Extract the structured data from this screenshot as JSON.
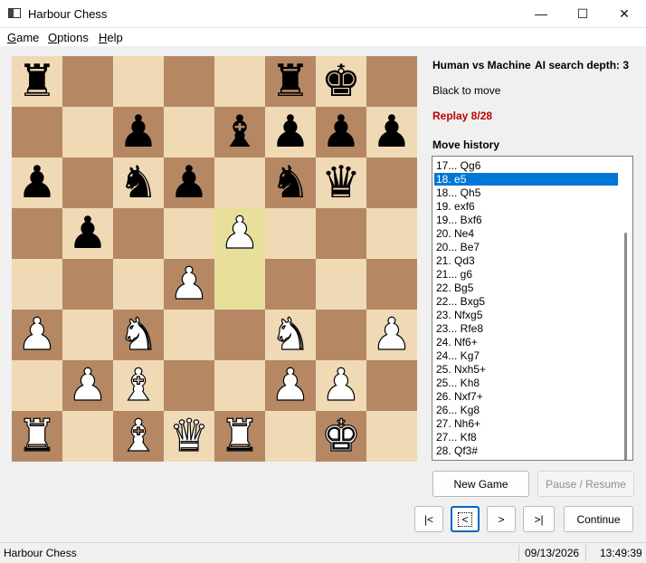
{
  "window": {
    "title": "Harbour Chess",
    "minimize": "—",
    "maximize": "☐",
    "close": "✕"
  },
  "menu": [
    {
      "accel": "G",
      "rest": "ame"
    },
    {
      "accel": "O",
      "rest": "ptions"
    },
    {
      "accel": "H",
      "rest": "elp"
    }
  ],
  "board": {
    "rows": [
      [
        "r",
        "",
        "",
        "",
        "",
        "r",
        "k",
        ""
      ],
      [
        "",
        "",
        "p",
        "",
        "b",
        "p",
        "p",
        "p"
      ],
      [
        "p",
        "",
        "n",
        "p",
        "",
        "n",
        "q",
        ""
      ],
      [
        "",
        "p",
        "",
        "",
        "P",
        "",
        "",
        ""
      ],
      [
        "",
        "",
        "",
        "P",
        "",
        "",
        "",
        ""
      ],
      [
        "P",
        "",
        "N",
        "",
        "",
        "N",
        "",
        "P"
      ],
      [
        "",
        "P",
        "B",
        "",
        "",
        "P",
        "P",
        ""
      ],
      [
        "R",
        "",
        "B",
        "Q",
        "R",
        "",
        "K",
        ""
      ]
    ],
    "highlight": [
      [
        3,
        4
      ],
      [
        4,
        4
      ]
    ],
    "colors": {
      "light": "#f0d9b5",
      "dark": "#b58863",
      "highlight": "#e8df9a"
    }
  },
  "info": {
    "players": "Human vs Machine",
    "depth": "AI search depth: 3",
    "to_move": "Black to move",
    "replay": "Replay 8/28",
    "history_label": "Move history"
  },
  "history": {
    "moves": [
      "17... Qg6",
      "18. e5",
      "18... Qh5",
      "19. exf6",
      "19... Bxf6",
      "20. Ne4",
      "20... Be7",
      "21. Qd3",
      "21... g6",
      "22. Bg5",
      "22... Bxg5",
      "23. Nfxg5",
      "23... Rfe8",
      "24. Nf6+",
      "24... Kg7",
      "25. Nxh5+",
      "25... Kh8",
      "26. Nxf7+",
      "26... Kg8",
      "27. Nh6+",
      "27... Kf8",
      "28. Qf3#"
    ],
    "selected_index": 1
  },
  "buttons": {
    "new_game": "New Game",
    "pause": "Pause / Resume",
    "first": "|<",
    "prev": "<",
    "next": ">",
    "last": ">|",
    "continue": "Continue"
  },
  "status": {
    "app": "Harbour Chess",
    "date": "09/13/2026",
    "time": "13:49:39"
  }
}
